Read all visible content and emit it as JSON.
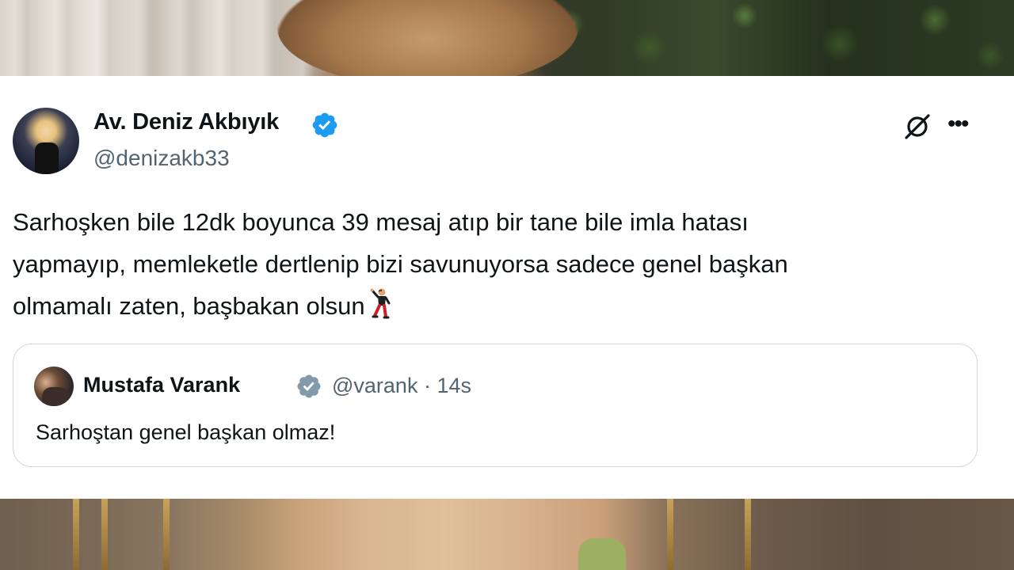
{
  "tweet": {
    "author_name": "Av. Deniz Akbıyık",
    "author_handle": "@denizakb33",
    "text_lines": [
      "Sarhoşken bile 12dk boyunca 39 mesaj atıp bir tane bile imla hatası",
      "yapmayıp, memleketle dertlenip bizi savunuyorsa sadece genel başkan",
      "olmamalı zaten, başbakan olsun"
    ],
    "more_label": "•••",
    "emoji": "man-dancing"
  },
  "quoted_tweet": {
    "author_name": "Mustafa Varank",
    "author_handle": "@varank",
    "separator": "·",
    "time": "14s",
    "text": "Sarhoştan genel başkan olmaz!"
  },
  "colors": {
    "verified_blue": "#1d9bf0",
    "quote_verified_gray": "#829aab",
    "secondary_text": "#536471",
    "primary_text": "#0f1419",
    "border": "#cfd9de"
  }
}
